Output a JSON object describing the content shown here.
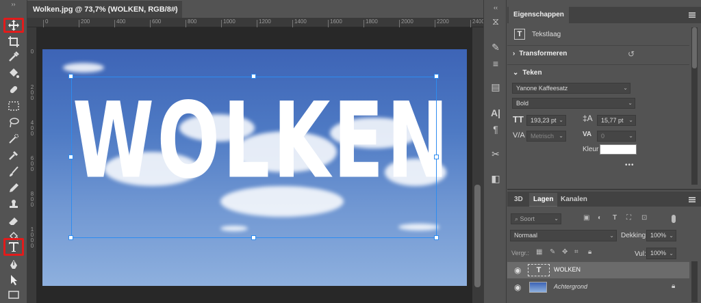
{
  "document": {
    "tab_title": "Wolken.jpg @ 73,7% (WOLKEN, RGB/8#) *",
    "close_glyph": "×",
    "ruler_h": [
      "0",
      "200",
      "400",
      "600",
      "800",
      "1000",
      "1200",
      "1400",
      "1600",
      "1800",
      "2000",
      "2200",
      "2400"
    ],
    "ruler_v": [
      "0",
      "2\n0\n0",
      "4\n0\n0",
      "6\n0\n0",
      "8\n0\n0",
      "1\n0\n0\n0"
    ],
    "canvas_text": "WOLKEN"
  },
  "toolbar": {
    "collapse": "››",
    "tools": [
      "move-icon",
      "crop-icon",
      "eyedropper-icon",
      "paint-bucket-icon",
      "healing-brush-icon",
      "marquee-icon",
      "lasso-icon",
      "brush-icon",
      "quick-select-icon",
      "color-sampler-icon",
      "pencil-icon",
      "stamp-icon",
      "eraser-icon",
      "fill-icon",
      "type-icon",
      "pen-icon",
      "path-select-icon",
      "rectangle-icon"
    ],
    "highlighted": [
      "move-icon",
      "type-icon"
    ]
  },
  "properties": {
    "tab": "Eigenschappen",
    "layer_kind_icon": "T",
    "layer_kind": "Tekstlaag",
    "transform_section": "Transformeren",
    "text_section": "Teken",
    "font_family": "Yanone Kaffeesatz",
    "font_style": "Bold",
    "font_size": "193,23 pt",
    "leading": "15,77 pt",
    "kerning": "Metrisch",
    "tracking": "0",
    "color_label": "Kleur",
    "color_value": "#ffffff",
    "more": "•••"
  },
  "layers_panel": {
    "tabs": [
      "3D",
      "Lagen",
      "Kanalen"
    ],
    "active_tab": "Lagen",
    "filter_placeholder": "Soort",
    "blend_mode": "Normaal",
    "opacity_label": "Dekking:",
    "opacity_value": "100%",
    "lock_label": "Vergr.:",
    "fill_label": "Vul:",
    "fill_value": "100%",
    "layers": [
      {
        "name": "WOLKEN",
        "type": "text",
        "selected": true
      },
      {
        "name": "Achtergrond",
        "type": "image",
        "locked": true
      }
    ]
  }
}
